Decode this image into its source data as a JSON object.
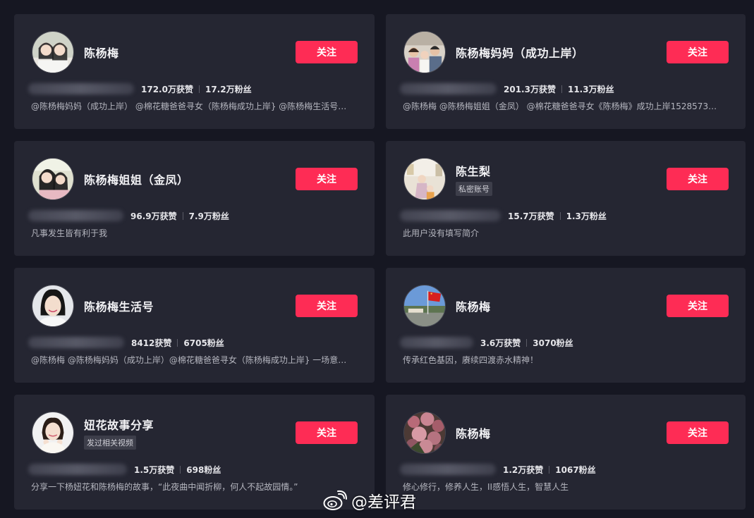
{
  "follow_label": "关注",
  "watermark": "@差评君",
  "accent_color": "#fe2c55",
  "users": [
    {
      "name": "陈杨梅",
      "tag": "",
      "likes": "172.0万获赞",
      "fans": "17.2万粉丝",
      "bio": "@陈杨梅妈妈（成功上岸） @棉花糖爸爸寻女（陈杨梅成功上岸} @陈杨梅生活号…",
      "avatar": "two-girls-photo"
    },
    {
      "name": "陈杨梅妈妈（成功上岸）",
      "tag": "",
      "likes": "201.3万获赞",
      "fans": "11.3万粉丝",
      "bio": "@陈杨梅 @陈杨梅姐姐（金凤） @棉花糖爸爸寻女《陈杨梅》成功上岸1528573…",
      "avatar": "family-photo"
    },
    {
      "name": "陈杨梅姐姐（金凤）",
      "tag": "",
      "likes": "96.9万获赞",
      "fans": "7.9万粉丝",
      "bio": "凡事发生皆有利于我",
      "avatar": "two-girls-photo"
    },
    {
      "name": "陈生梨",
      "tag": "私密账号",
      "likes": "15.7万获赞",
      "fans": "1.3万粉丝",
      "bio": "此用户没有填写简介",
      "avatar": "indoor-photo"
    },
    {
      "name": "陈杨梅生活号",
      "tag": "",
      "likes": "8412获赞",
      "fans": "6705粉丝",
      "bio": "@陈杨梅 @陈杨梅妈妈（成功上岸）@棉花糖爸爸寻女（陈杨梅成功上岸} 一场意…",
      "avatar": "portrait-photo"
    },
    {
      "name": "陈杨梅",
      "tag": "",
      "likes": "3.6万获赞",
      "fans": "3070粉丝",
      "bio": "传承红色基因，赓续四渡赤水精神！",
      "avatar": "flag-photo"
    },
    {
      "name": "妞花故事分享",
      "tag": "发过相关视频",
      "likes": "1.5万获赞",
      "fans": "698粉丝",
      "bio": "分享一下杨妞花和陈杨梅的故事，“此夜曲中闻折柳，何人不起故园情。”",
      "avatar": "portrait-photo"
    },
    {
      "name": "陈杨梅",
      "tag": "",
      "likes": "1.2万获赞",
      "fans": "1067粉丝",
      "bio": "修心修行，修养人生，II感悟人生，智慧人生",
      "avatar": "flowers-photo"
    }
  ]
}
